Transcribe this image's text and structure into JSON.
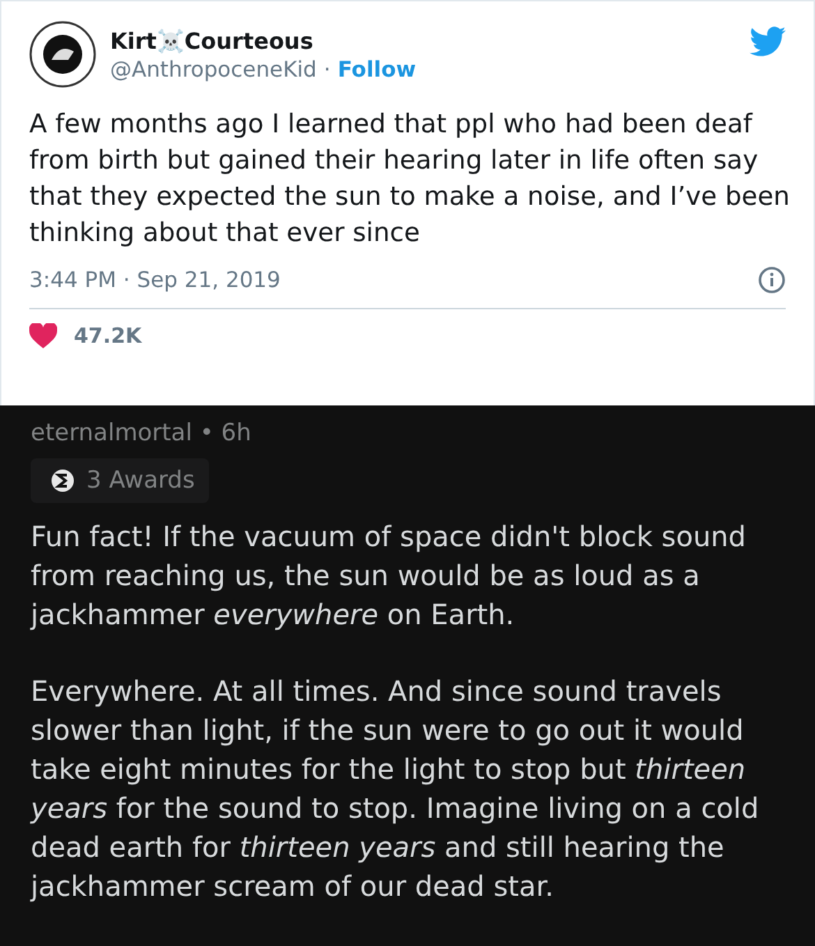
{
  "tweet": {
    "name": "Kirt☠️Courteous",
    "handle": "@AnthropoceneKid",
    "separator": "·",
    "follow": "Follow",
    "text": "A few months ago I learned that ppl who had been deaf from birth but gained their hearing later in life often say that they expected the sun to make a noise, and I’ve been thinking about that ever since",
    "timestamp": "3:44 PM · Sep 21, 2019",
    "likes": "47.2K"
  },
  "comment": {
    "author": "eternalmortal • 6h",
    "awards": "3 Awards",
    "paragraphs": [
      "Fun fact! If the vacuum of space didn't block sound from reaching us, the sun would be as loud as a jackhammer *everywhere* on Earth.",
      "Everywhere. At all times. And since sound travels slower than light, if the sun were to go out it would take eight minutes for the light to stop but *thirteen years* for the sound to stop. Imagine living on a cold dead earth for *thirteen years* and still hearing the jackhammer scream of our dead star."
    ]
  }
}
